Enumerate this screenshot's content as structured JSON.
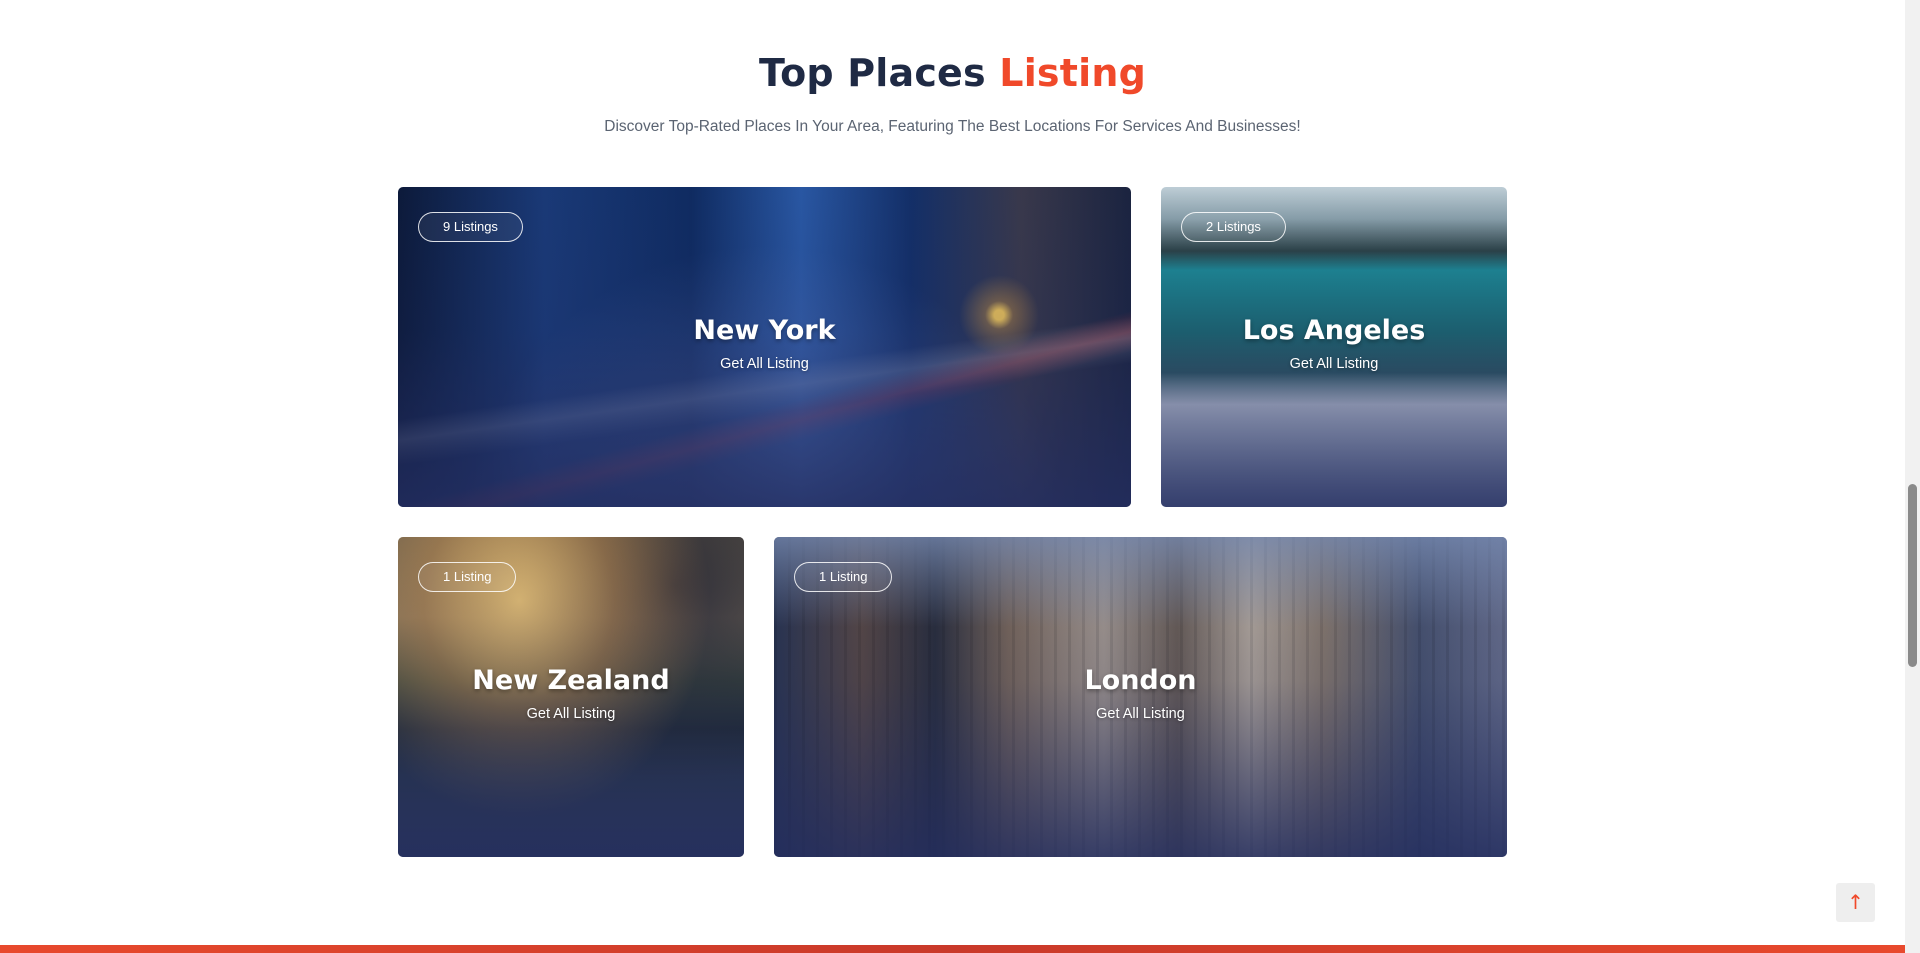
{
  "section": {
    "title_main": "Top Places",
    "title_accent": "Listing",
    "subtitle": "Discover Top-Rated Places In Your Area, Featuring The Best Locations For Services And Businesses!"
  },
  "places": [
    {
      "name": "New York",
      "badge": "9 Listings",
      "link": "Get All Listing"
    },
    {
      "name": "Los Angeles",
      "badge": "2 Listings",
      "link": "Get All Listing"
    },
    {
      "name": "New Zealand",
      "badge": "1 Listing",
      "link": "Get All Listing"
    },
    {
      "name": "London",
      "badge": "1 Listing",
      "link": "Get All Listing"
    }
  ],
  "scroll_top": {
    "icon": "arrow-up-icon",
    "glyph": "↑"
  },
  "colors": {
    "accent": "#f0492a",
    "heading": "#1f2a44"
  }
}
